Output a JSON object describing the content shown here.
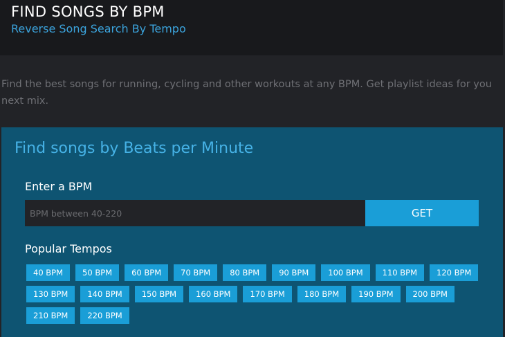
{
  "header": {
    "title": "FIND SONGS BY BPM",
    "subtitle": "Reverse Song Search By Tempo"
  },
  "intro": "Find the best songs for running, cycling and other workouts at any BPM. Get playlist ideas for you next mix.",
  "panel": {
    "title": "Find songs by Beats per Minute",
    "input_label": "Enter a BPM",
    "input_placeholder": "BPM between 40-220",
    "input_value": "",
    "get_label": "GET",
    "popular_label": "Popular Tempos",
    "tempos": [
      "40 BPM",
      "50 BPM",
      "60 BPM",
      "70 BPM",
      "80 BPM",
      "90 BPM",
      "100 BPM",
      "110 BPM",
      "120 BPM",
      "130 BPM",
      "140 BPM",
      "150 BPM",
      "160 BPM",
      "170 BPM",
      "180 BPM",
      "190 BPM",
      "200 BPM",
      "210 BPM",
      "220 BPM"
    ]
  },
  "colors": {
    "background": "#222327",
    "header_bg": "#18191c",
    "accent": "#3ba3dc",
    "panel_bg": "#0e5472",
    "button": "#1a9ed7"
  }
}
